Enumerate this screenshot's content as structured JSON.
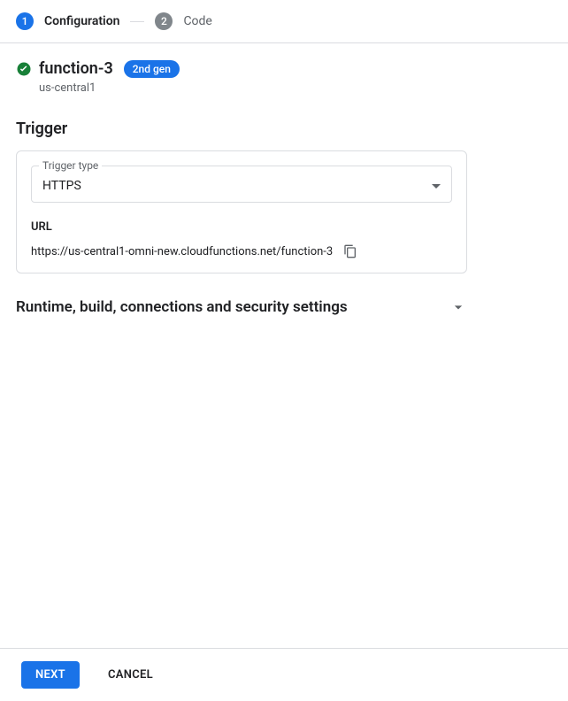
{
  "stepper": {
    "steps": [
      {
        "num": "1",
        "label": "Configuration",
        "active": true
      },
      {
        "num": "2",
        "label": "Code",
        "active": false
      }
    ]
  },
  "function": {
    "name": "function-3",
    "gen_badge": "2nd gen",
    "region": "us-central1"
  },
  "trigger": {
    "section_title": "Trigger",
    "type_label": "Trigger type",
    "type_value": "HTTPS",
    "url_label": "URL",
    "url_value": "https://us-central1-omni-new.cloudfunctions.net/function-3"
  },
  "expander": {
    "title": "Runtime, build, connections and security settings"
  },
  "footer": {
    "next": "Next",
    "cancel": "Cancel"
  }
}
